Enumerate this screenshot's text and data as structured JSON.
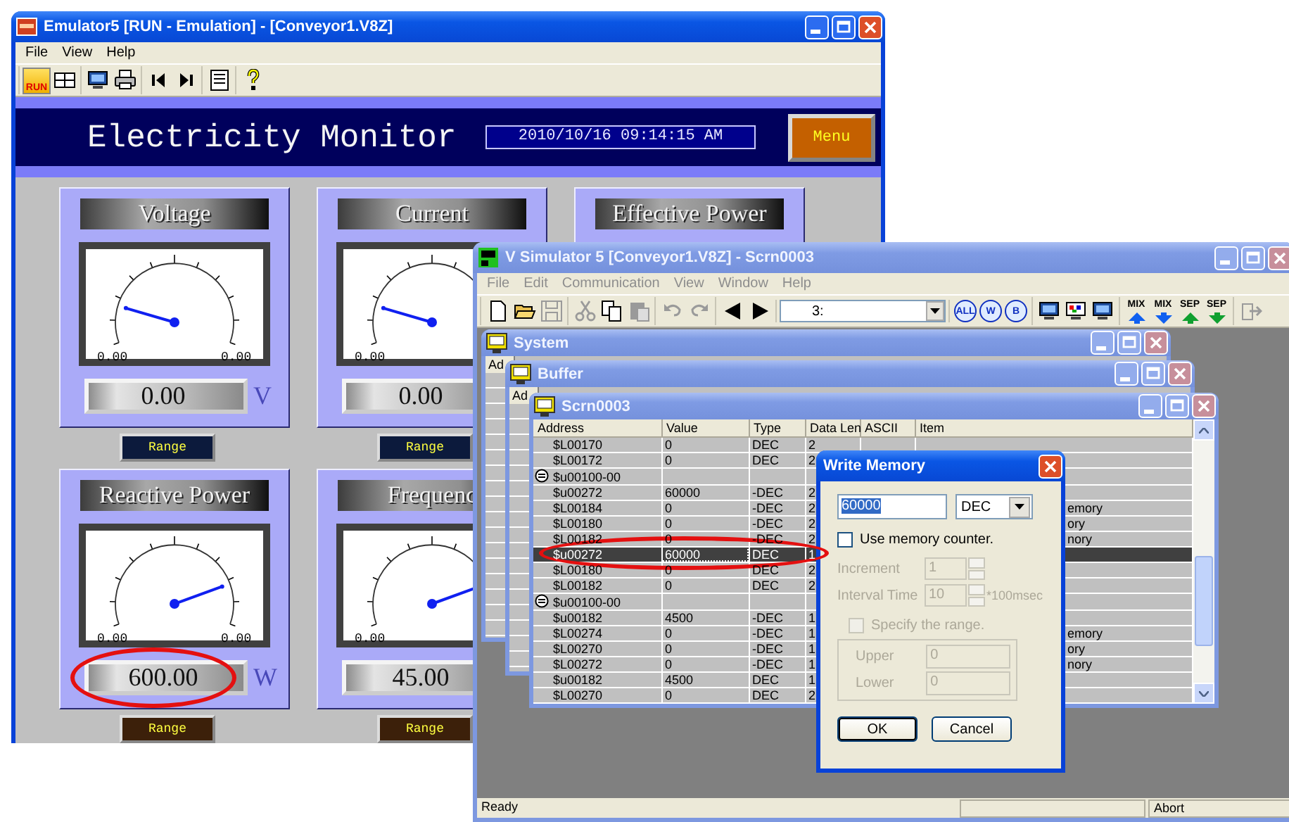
{
  "emulator_window": {
    "title": "Emulator5 [RUN - Emulation] - [Conveyor1.V8Z]",
    "active": true,
    "menu": [
      {
        "label": "File"
      },
      {
        "label": "View"
      },
      {
        "label": "Help"
      }
    ],
    "toolbar": [
      [
        {
          "kind": "run",
          "label": "RUN"
        },
        {
          "kind": "grid"
        }
      ],
      [
        {
          "kind": "monitor"
        },
        {
          "kind": "print"
        }
      ],
      [
        {
          "kind": "prev"
        },
        {
          "kind": "next"
        }
      ],
      [
        {
          "kind": "list"
        }
      ],
      [
        {
          "kind": "help"
        }
      ]
    ],
    "screen": {
      "title": "Electricity Monitor",
      "datetime": "2010/10/16 09:14:15 AM",
      "menu_button": "Menu",
      "gauges": [
        {
          "title": "Voltage",
          "level": 0.02,
          "min_label": "0.00",
          "max_label": "0.00",
          "reading": "0.00",
          "unit": "V",
          "highlighted": false,
          "range_button": {
            "label": "Range",
            "color": "#0c1a3c"
          }
        },
        {
          "title": "Current",
          "level": 0.02,
          "min_label": "0.00",
          "reading": "0.00",
          "highlighted": false,
          "range_button": {
            "label": "Range",
            "color": "#0c1a3c"
          }
        },
        {
          "title": "Effective Power"
        },
        {
          "title": "Reactive Power",
          "level": 0.97,
          "min_label": "0.00",
          "max_label": "0.00",
          "reading": "600.00",
          "unit": "W",
          "highlighted": true,
          "range_button": {
            "label": "Range",
            "color": "#3c200a"
          }
        },
        {
          "title": "Frequenc",
          "level": 0.97,
          "min_label": "0.00",
          "reading": "45.00",
          "highlighted": false,
          "range_button": {
            "label": "Range",
            "color": "#3c200a"
          }
        }
      ]
    }
  },
  "simulator_window": {
    "title": "V Simulator 5 [Conveyor1.V8Z] - Scrn0003",
    "active": false,
    "menu": [
      {
        "label": "File",
        "disabled": true
      },
      {
        "label": "Edit",
        "disabled": true
      },
      {
        "label": "Communication",
        "disabled": true
      },
      {
        "label": "View",
        "disabled": true
      },
      {
        "label": "Window",
        "disabled": true
      },
      {
        "label": "Help",
        "disabled": true
      }
    ],
    "toolbar": [
      [
        {
          "kind": "new",
          "disabled": false
        },
        {
          "kind": "open",
          "disabled": false
        },
        {
          "kind": "save",
          "disabled": true
        }
      ],
      [
        {
          "kind": "cut",
          "disabled": true
        },
        {
          "kind": "copy",
          "disabled": false
        },
        {
          "kind": "paste",
          "disabled": true
        }
      ],
      [
        {
          "kind": "undo",
          "disabled": true
        },
        {
          "kind": "redo",
          "disabled": true
        }
      ],
      [
        {
          "kind": "back",
          "disabled": false
        },
        {
          "kind": "forward",
          "disabled": false
        }
      ],
      [
        {
          "kind": "select",
          "value": "3:"
        }
      ],
      [
        {
          "kind": "circle",
          "label": "ALL"
        },
        {
          "kind": "circle",
          "label": "W"
        },
        {
          "kind": "circle",
          "label": "B"
        }
      ],
      [
        {
          "kind": "monitor"
        },
        {
          "kind": "monitor-color"
        },
        {
          "kind": "monitor"
        }
      ],
      [
        {
          "kind": "arrow-up",
          "label": "MIX"
        },
        {
          "kind": "arrow-down",
          "label": "MIX"
        },
        {
          "kind": "arrow-up-green",
          "label": "SEP"
        },
        {
          "kind": "arrow-down-green",
          "label": "SEP"
        }
      ],
      [
        {
          "kind": "exit",
          "disabled": true
        }
      ]
    ],
    "children": [
      {
        "kind": "stub",
        "title": "System",
        "active": false,
        "header_stub": "Ad"
      },
      {
        "kind": "stub",
        "title": "Buffer",
        "active": false,
        "header_stub": "Ad"
      },
      {
        "kind": "table",
        "title": "Scrn0003",
        "active": false,
        "columns": [
          "Address",
          "Value",
          "Type",
          "Data Len",
          "ASCII",
          "Item"
        ],
        "rows": [
          {
            "kind": "address",
            "address": "$L00170",
            "value": "0",
            "type": "DEC",
            "data_len": "2",
            "selected": false,
            "highlighted": false
          },
          {
            "kind": "address",
            "address": "$L00172",
            "value": "0",
            "type": "DEC",
            "data_len": "2",
            "selected": false,
            "highlighted": false
          },
          {
            "kind": "group",
            "address": "$u00100-00",
            "selected": false,
            "highlighted": false
          },
          {
            "kind": "address",
            "address": "$u00272",
            "value": "60000",
            "type": "-DEC",
            "data_len": "2",
            "selected": false,
            "highlighted": false
          },
          {
            "kind": "address",
            "address": "$L00184",
            "value": "0",
            "type": "-DEC",
            "data_len": "2",
            "item": "emory",
            "selected": false,
            "highlighted": false
          },
          {
            "kind": "address",
            "address": "$L00180",
            "value": "0",
            "type": "-DEC",
            "data_len": "2",
            "item": "ory",
            "selected": false,
            "highlighted": false
          },
          {
            "kind": "address",
            "address": "$L00182",
            "value": "0",
            "type": "-DEC",
            "data_len": "2",
            "item": "nory",
            "selected": false,
            "highlighted": false
          },
          {
            "kind": "address",
            "address": "$u00272",
            "value": "60000",
            "type": "DEC",
            "data_len": "1",
            "selected": true,
            "highlighted": true
          },
          {
            "kind": "address",
            "address": "$L00180",
            "value": "0",
            "type": "DEC",
            "data_len": "2",
            "selected": false,
            "highlighted": false
          },
          {
            "kind": "address",
            "address": "$L00182",
            "value": "0",
            "type": "DEC",
            "data_len": "2",
            "selected": false,
            "highlighted": false
          },
          {
            "kind": "group",
            "address": "$u00100-00",
            "selected": false,
            "highlighted": false
          },
          {
            "kind": "address",
            "address": "$u00182",
            "value": "4500",
            "type": "-DEC",
            "data_len": "1",
            "selected": false,
            "highlighted": false
          },
          {
            "kind": "address",
            "address": "$L00274",
            "value": "0",
            "type": "-DEC",
            "data_len": "1",
            "item": "emory",
            "selected": false,
            "highlighted": false
          },
          {
            "kind": "address",
            "address": "$L00270",
            "value": "0",
            "type": "-DEC",
            "data_len": "1",
            "item": "ory",
            "selected": false,
            "highlighted": false
          },
          {
            "kind": "address",
            "address": "$L00272",
            "value": "0",
            "type": "-DEC",
            "data_len": "1",
            "item": "nory",
            "selected": false,
            "highlighted": false
          },
          {
            "kind": "address",
            "address": "$u00182",
            "value": "4500",
            "type": "DEC",
            "data_len": "1",
            "selected": false,
            "highlighted": false
          },
          {
            "kind": "address",
            "address": "$L00270",
            "value": "0",
            "type": "DEC",
            "data_len": "2",
            "selected": false,
            "highlighted": false
          }
        ]
      }
    ],
    "status_bar": {
      "message": "Ready",
      "right": "Abort"
    }
  },
  "dialog": {
    "title": "Write Memory",
    "active": true,
    "value": "60000",
    "text_selected": true,
    "format": "DEC",
    "use_counter": {
      "label": "Use memory counter.",
      "checked": false
    },
    "fields": [
      {
        "label": "Increment",
        "value": "1",
        "disabled": true
      },
      {
        "label": "Interval Time",
        "value": "10",
        "suffix": "*100msec",
        "disabled": true
      }
    ],
    "range": {
      "label": "Specify the range.",
      "checked": false,
      "disabled": true,
      "fields": [
        {
          "label": "Upper",
          "value": "0"
        },
        {
          "label": "Lower",
          "value": "0"
        }
      ]
    },
    "buttons": [
      {
        "label": "OK",
        "default": true
      },
      {
        "label": "Cancel",
        "default": false
      }
    ]
  }
}
